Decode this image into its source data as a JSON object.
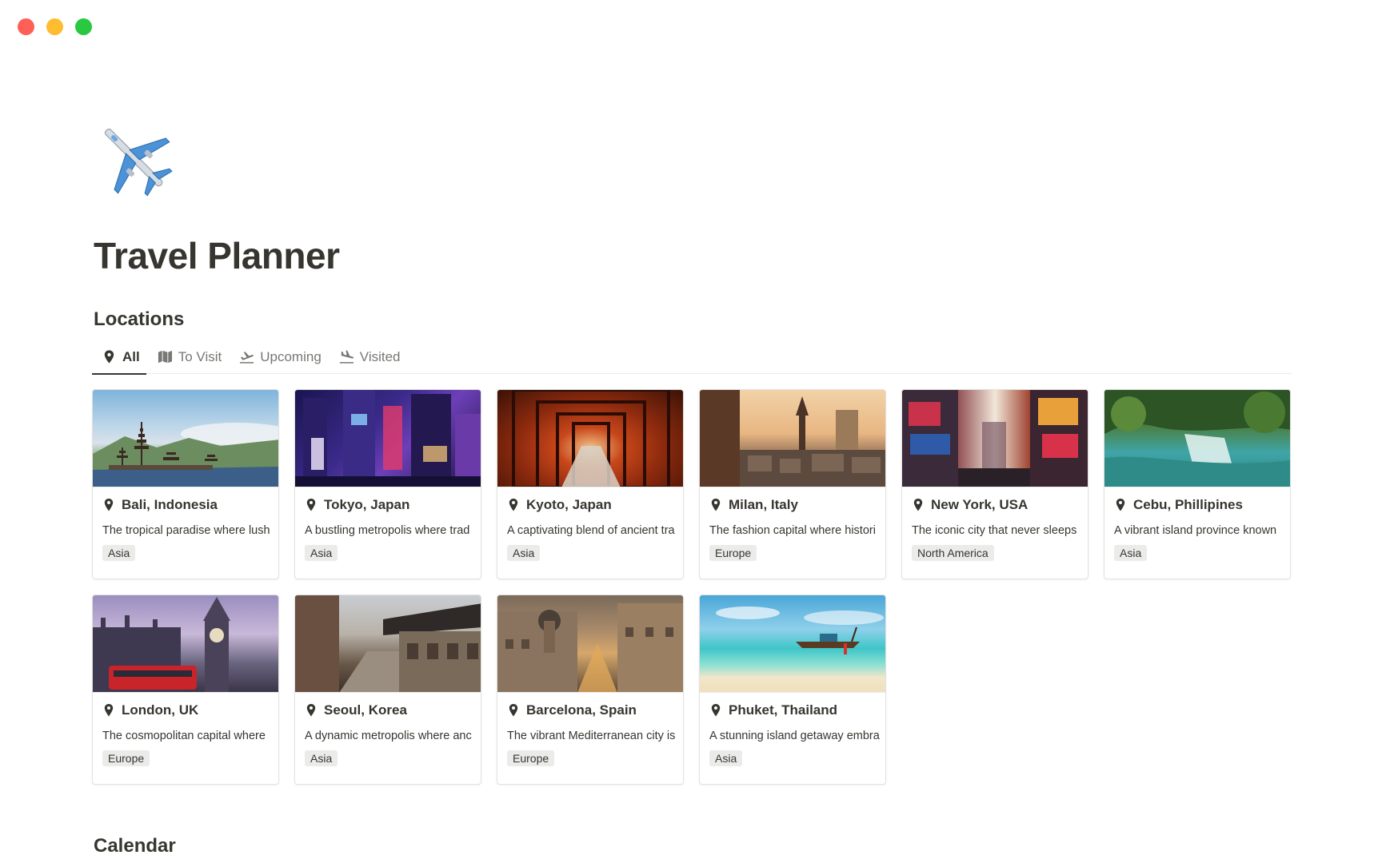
{
  "page": {
    "icon": "airplane-icon",
    "title": "Travel Planner"
  },
  "locations": {
    "heading": "Locations",
    "tabs": [
      {
        "label": "All",
        "icon": "map-pin-icon",
        "active": true
      },
      {
        "label": "To Visit",
        "icon": "map-icon",
        "active": false
      },
      {
        "label": "Upcoming",
        "icon": "airplane-takeoff-icon",
        "active": false
      },
      {
        "label": "Visited",
        "icon": "airplane-landing-icon",
        "active": false
      }
    ],
    "cards": [
      {
        "title": "Bali, Indonesia",
        "desc": "The tropical paradise where lush",
        "tag": "Asia"
      },
      {
        "title": "Tokyo, Japan",
        "desc": "A bustling metropolis where trad",
        "tag": "Asia"
      },
      {
        "title": "Kyoto, Japan",
        "desc": "A captivating blend of ancient tra",
        "tag": "Asia"
      },
      {
        "title": "Milan, Italy",
        "desc": "The fashion capital where histori",
        "tag": "Europe"
      },
      {
        "title": "New York, USA",
        "desc": "The iconic city that never sleeps",
        "tag": "North America"
      },
      {
        "title": "Cebu, Phillipines",
        "desc": "A vibrant island province known",
        "tag": "Asia"
      },
      {
        "title": "London, UK",
        "desc": "The cosmopolitan capital where",
        "tag": "Europe"
      },
      {
        "title": "Seoul, Korea",
        "desc": "A dynamic metropolis where anc",
        "tag": "Asia"
      },
      {
        "title": "Barcelona, Spain",
        "desc": "The vibrant Mediterranean city is",
        "tag": "Europe"
      },
      {
        "title": "Phuket, Thailand",
        "desc": "A stunning island getaway embra",
        "tag": "Asia"
      }
    ]
  },
  "calendar": {
    "heading": "Calendar"
  },
  "colors": {
    "text": "#37352f",
    "muted": "#787774",
    "tag_bg": "#ebebea",
    "border": "#e3e2de"
  }
}
